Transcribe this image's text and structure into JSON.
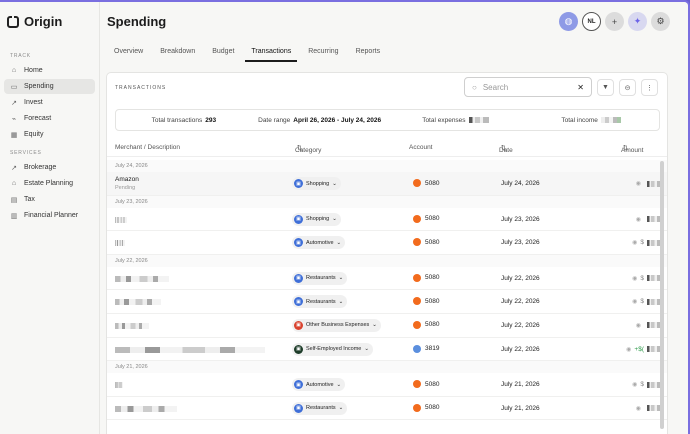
{
  "app": {
    "name": "Origin"
  },
  "sidebar": {
    "sections": [
      {
        "label": "TRACK",
        "items": [
          {
            "label": "Home",
            "icon": "home-icon",
            "active": false
          },
          {
            "label": "Spending",
            "icon": "wallet-icon",
            "active": true
          },
          {
            "label": "Invest",
            "icon": "invest-icon",
            "active": false
          },
          {
            "label": "Forecast",
            "icon": "forecast-icon",
            "active": false
          },
          {
            "label": "Equity",
            "icon": "equity-icon",
            "active": false
          }
        ]
      },
      {
        "label": "SERVICES",
        "items": [
          {
            "label": "Brokerage",
            "icon": "brokerage-icon",
            "active": false
          },
          {
            "label": "Estate Planning",
            "icon": "estate-icon",
            "active": false
          },
          {
            "label": "Tax",
            "icon": "tax-icon",
            "active": false
          },
          {
            "label": "Financial Planner",
            "icon": "planner-icon",
            "active": false
          }
        ]
      }
    ]
  },
  "header": {
    "title": "Spending",
    "avatar_initials": "NL",
    "tabs": [
      "Overview",
      "Breakdown",
      "Budget",
      "Transactions",
      "Recurring",
      "Reports"
    ],
    "active_tab": "Transactions"
  },
  "transactions": {
    "heading": "TRANSACTIONS",
    "search_placeholder": "Search",
    "stats": {
      "total_label": "Total transactions",
      "total_value": "293",
      "range_label": "Date range",
      "range_value": "April 26, 2026 - July 24, 2026",
      "expenses_label": "Total expenses",
      "income_label": "Total income"
    },
    "columns": {
      "merchant": "Merchant / Description",
      "category": "Category",
      "account": "Account",
      "date": "Date",
      "amount": "Amount"
    },
    "groups": [
      {
        "date": "July 24, 2026",
        "rows": [
          {
            "merchant": "Amazon",
            "sub": "Pending",
            "category": "Shopping",
            "cat_color": "#3f6fd8",
            "account": "5080",
            "acct_color": "orange",
            "date": "July 24, 2026",
            "amount": ""
          }
        ]
      },
      {
        "date": "July 23, 2026",
        "rows": [
          {
            "merchant": "",
            "category": "Shopping",
            "cat_color": "#3f6fd8",
            "account": "5080",
            "acct_color": "orange",
            "date": "July 23, 2026",
            "amount": ""
          },
          {
            "merchant": "",
            "category": "Automotive",
            "cat_color": "#3f6fd8",
            "account": "5080",
            "acct_color": "orange",
            "date": "July 23, 2026",
            "amount": "$"
          }
        ]
      },
      {
        "date": "July 22, 2026",
        "rows": [
          {
            "merchant": "",
            "category": "Restaurants",
            "cat_color": "#3f6fd8",
            "account": "5080",
            "acct_color": "orange",
            "date": "July 22, 2026",
            "amount": "$"
          },
          {
            "merchant": "",
            "category": "Restaurants",
            "cat_color": "#3f6fd8",
            "account": "5080",
            "acct_color": "orange",
            "date": "July 22, 2026",
            "amount": "$"
          },
          {
            "merchant": "",
            "category": "Other Business Expenses",
            "cat_color": "#d9432f",
            "account": "5080",
            "acct_color": "orange",
            "date": "July 22, 2026",
            "amount": ""
          },
          {
            "merchant": "",
            "category": "Self-Employed Income",
            "cat_color": "#1e3d2a",
            "account": "3819",
            "acct_color": "blue",
            "date": "July 22, 2026",
            "amount": "+$("
          }
        ]
      },
      {
        "date": "July 21, 2026",
        "rows": [
          {
            "merchant": "",
            "category": "Automotive",
            "cat_color": "#3f6fd8",
            "account": "5080",
            "acct_color": "orange",
            "date": "July 21, 2026",
            "amount": "$"
          },
          {
            "merchant": "",
            "category": "Restaurants",
            "cat_color": "#3f6fd8",
            "account": "5080",
            "acct_color": "orange",
            "date": "July 21, 2026",
            "amount": ""
          }
        ]
      }
    ]
  }
}
